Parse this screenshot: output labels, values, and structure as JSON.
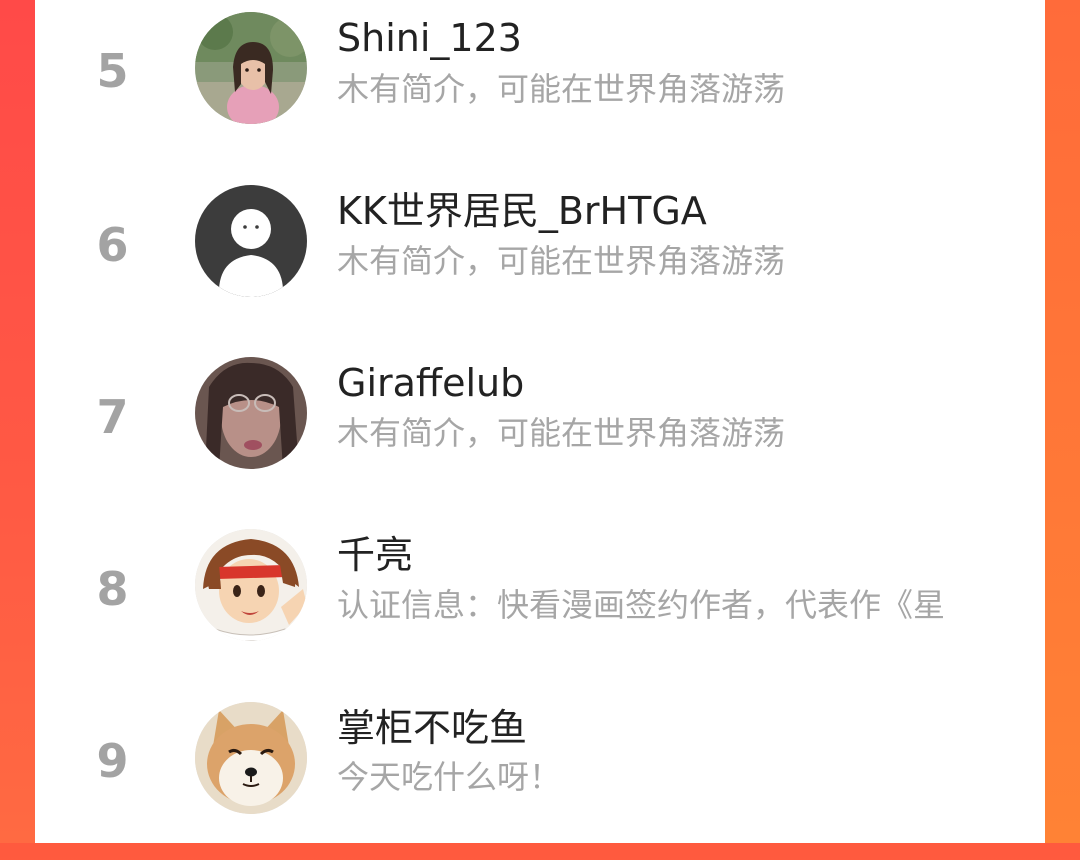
{
  "ranking": {
    "entries": [
      {
        "rank": "5",
        "name": "Shini_123",
        "bio": "木有简介，可能在世界角落游荡",
        "avatar_icon": "woman-photo-avatar"
      },
      {
        "rank": "6",
        "name": "KK世界居民_BrHTGA",
        "bio": "木有简介，可能在世界角落游荡",
        "avatar_icon": "default-user-avatar"
      },
      {
        "rank": "7",
        "name": "Giraffelub",
        "bio": "木有简介，可能在世界角落游荡",
        "avatar_icon": "woman-glasses-avatar"
      },
      {
        "rank": "8",
        "name": "千亮",
        "bio": "认证信息：快看漫画签约作者，代表作《星",
        "avatar_icon": "anime-character-avatar"
      },
      {
        "rank": "9",
        "name": "掌柜不吃鱼",
        "bio": "今天吃什么呀！",
        "avatar_icon": "shiba-dog-avatar"
      }
    ]
  },
  "colors": {
    "accent_left": "#ff4a48",
    "accent_right": "#ff7a38",
    "rank_gray": "#a3a3a3",
    "name_text": "#222222",
    "bio_text": "#a6a6a6"
  }
}
